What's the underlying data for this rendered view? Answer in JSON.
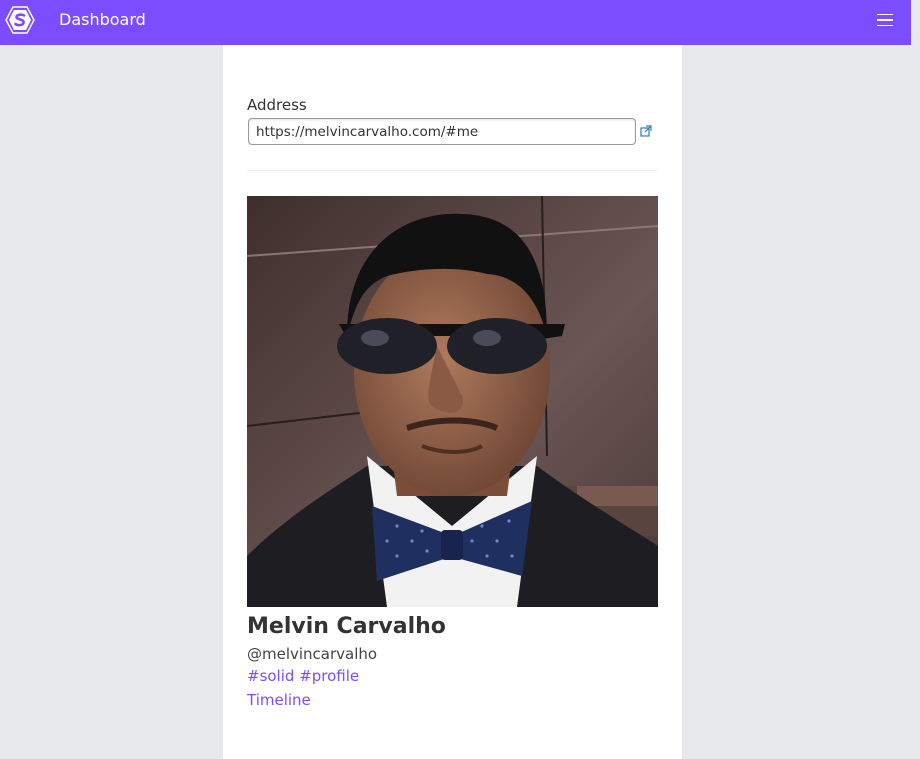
{
  "header": {
    "title": "Dashboard",
    "logo_icon": "solid-hexagon-logo-icon",
    "menu_icon": "hamburger-menu-icon",
    "accent_color": "#7c4dff"
  },
  "address": {
    "label": "Address",
    "value": "https://melvincarvalho.com/#me",
    "open_icon": "external-link-icon"
  },
  "profile": {
    "name": "Melvin Carvalho",
    "handle": "@melvincarvalho",
    "tags": [
      "#solid",
      "#profile"
    ],
    "timeline_label": "Timeline"
  }
}
